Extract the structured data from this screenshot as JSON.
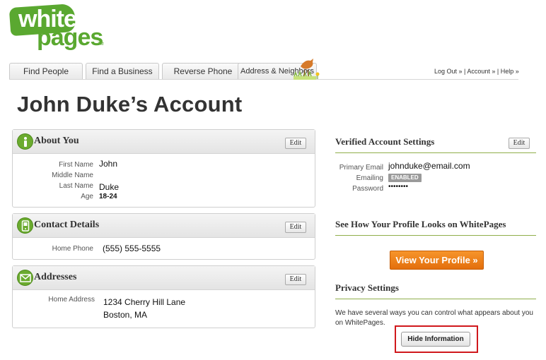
{
  "logo": {
    "line1": "white",
    "line2": "pages",
    "tm": "TM"
  },
  "tabs": [
    "Find People",
    "Find a Business",
    "Reverse Phone",
    "Address & Neighbors"
  ],
  "toplinks": {
    "logout": "Log Out",
    "account": "Account",
    "help": "Help",
    "sep1": " » | ",
    "sep2": " » | ",
    "sep3": " »"
  },
  "page_title": "John Duke’s Account",
  "colors": {
    "brand_green": "#5aa830",
    "orange": "#f08a1e",
    "highlight_red": "#d0181c"
  },
  "about": {
    "title": "About You",
    "edit": "Edit",
    "icon": "info-icon",
    "fields": [
      {
        "label": "First Name",
        "value": "John"
      },
      {
        "label": "Middle Name",
        "value": ""
      },
      {
        "label": "Last Name",
        "value": "Duke"
      },
      {
        "label": "Age",
        "value": "18-24"
      }
    ]
  },
  "contact": {
    "title": "Contact Details",
    "edit": "Edit",
    "icon": "phone-icon",
    "fields": [
      {
        "label": "Home Phone",
        "value": "(555) 555-5555"
      }
    ]
  },
  "addresses": {
    "title": "Addresses",
    "edit": "Edit",
    "icon": "envelope-icon",
    "label": "Home Address",
    "line1": "1234 Cherry Hill Lane",
    "line2": "Boston, MA"
  },
  "verified": {
    "title": "Verified Account Settings",
    "edit": "Edit",
    "email_label": "Primary Email",
    "email": "johnduke@email.com",
    "emailing_label": "Emailing",
    "emailing_badge": "ENABLED",
    "password_label": "Password",
    "password": "••••••••"
  },
  "profile": {
    "title": "See How Your Profile Looks on WhitePages",
    "button": "View Your Profile »"
  },
  "privacy": {
    "title": "Privacy Settings",
    "text": "We have several ways you can control what appears about you on WhitePages.",
    "button": "Hide Information"
  }
}
